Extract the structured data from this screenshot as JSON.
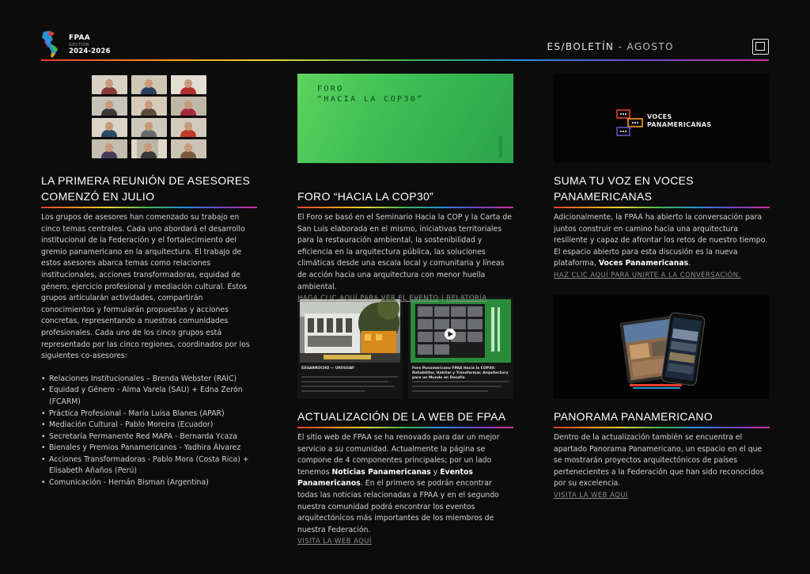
{
  "header": {
    "org": "FPAA",
    "org_sub": "GESTIÓN",
    "years": "2024-2026",
    "title_main": "ES/BOLETÍN",
    "title_sep": " - ",
    "title_month": "AGOSTO"
  },
  "col1": {
    "heading_line1": "LA PRIMERA REUNIÓN DE ASESORES",
    "heading_line2": "COMENZÓ EN JULIO",
    "paragraph": "Los grupos de asesores han comenzado su trabajo en cinco temas centrales. Cada uno abordará el desarrollo institucional de la Federación y el fortalecimiento del gremio panamericano en la arquitectura. El trabajo de estos asesores abarca temas como relaciones institucionales, acciones transformadoras, equidad de género, ejercicio profesional y mediación cultural. Estos grupos articularán actividades, compartirán conocimientos y formularán propuestas y acciones concretas, representando a nuestras comunidades profesionales. Cada uno de los cinco grupos está representado por las cinco regiones, coordinados por los siguientes co-asesores:",
    "bullets": [
      "Relaciones Institucionales – Brenda Webster (RAIC)",
      "Equidad y Género - Alma Varela (SAU) + Edna Zerón (FCARM)",
      "Práctica Profesional - María Luisa Blanes (APAR)",
      "Mediación Cultural - Pablo Moreira (Ecuador)",
      "Secretaría Permanente Red MAPA - Bernarda Ycaza",
      "Bienales y Premios Panamericanos - Yadhira Álvarez",
      "Acciones Transformadoras - Pablo Mora (Costa Rica) + Elisabeth Añaños (Perú)",
      "Comunicación - Hernán Bisman (Argentina)"
    ]
  },
  "col2": {
    "image_text_1": "FORO",
    "image_text_2": "“HACIA LA COP30”",
    "heading": "FORO “HACIA LA COP30”",
    "paragraph": "El Foro se basó en el Seminario Hacia la COP y la Carta de San Luis elaborada en el mismo, iniciativas territoriales para la restauración ambiental, la sostenibilidad y eficiencia en la arquitectura pública, las soluciones climáticas desde una escala local y comunitaria y líneas de acción hacia una arquitectura con menor huella ambiental.",
    "link_event": "HAGA CLIC AQUÍ PARA VER EL EVENTO",
    "link_sep": " | ",
    "link_relatoria": "RELATORÍA",
    "thumb_a_title": "ESGARROCHO — URUGUAY",
    "thumb_b_title": "Foro Panamericano FPAA Hacia la COP30: Rehabilitar, Habitar y Transformar. Arquitectura para un Mundo en Desafío",
    "heading2": "ACTUALIZACIÓN DE LA WEB DE FPAA",
    "paragraph2_a": "El sitio web de FPAA se ha renovado para dar un mejor servicio a su comunidad. Actualmente la página se compone de 4 componentes principales; por un lado tenemos ",
    "paragraph2_b1": "Noticias Panamericanas",
    "paragraph2_and": " y ",
    "paragraph2_b2": "Eventos Panamericanos",
    "paragraph2_c": ". En el primero se podrán encontrar todas las noticias relacionadas a FPAA y en el segundo nuestra comunidad podrá encontrar los eventos arquitectónicos más importantes de los miembros de nuestra Federación.",
    "link_web": "VISITA LA WEB AQUÍ"
  },
  "col3": {
    "voces_line1": "VOCES",
    "voces_line2": "PANAMERICANAS",
    "heading_line1": "SUMA TU VOZ EN VOCES",
    "heading_line2": "PANAMERICANAS",
    "paragraph_a": "Adicionalmente, la FPAA ha abierto la conversación para juntos construir en camino hacia una arquitectura resiliente y capaz de afrontar los retos de nuestro tiempo. El espacio abierto para esta discusión es la nueva plataforma, ",
    "paragraph_b": "Voces Panamericanas",
    "paragraph_c": ".",
    "link_join": "HAZ CLIC AQUÍ PARA UNIRTE A LA CONVERSACIÓN.",
    "heading2": "PANORAMA PANAMERICANO",
    "paragraph2": "Dentro de la actualización también se encuentra el apartado Panorama Panamericano, un espacio en el que se mostrarán proyectos arquitectónicos de países pertenecientes a la Federación que han sido reconocidos por su excelencia.",
    "link_web": "VISITA LA WEB AQUÍ"
  }
}
